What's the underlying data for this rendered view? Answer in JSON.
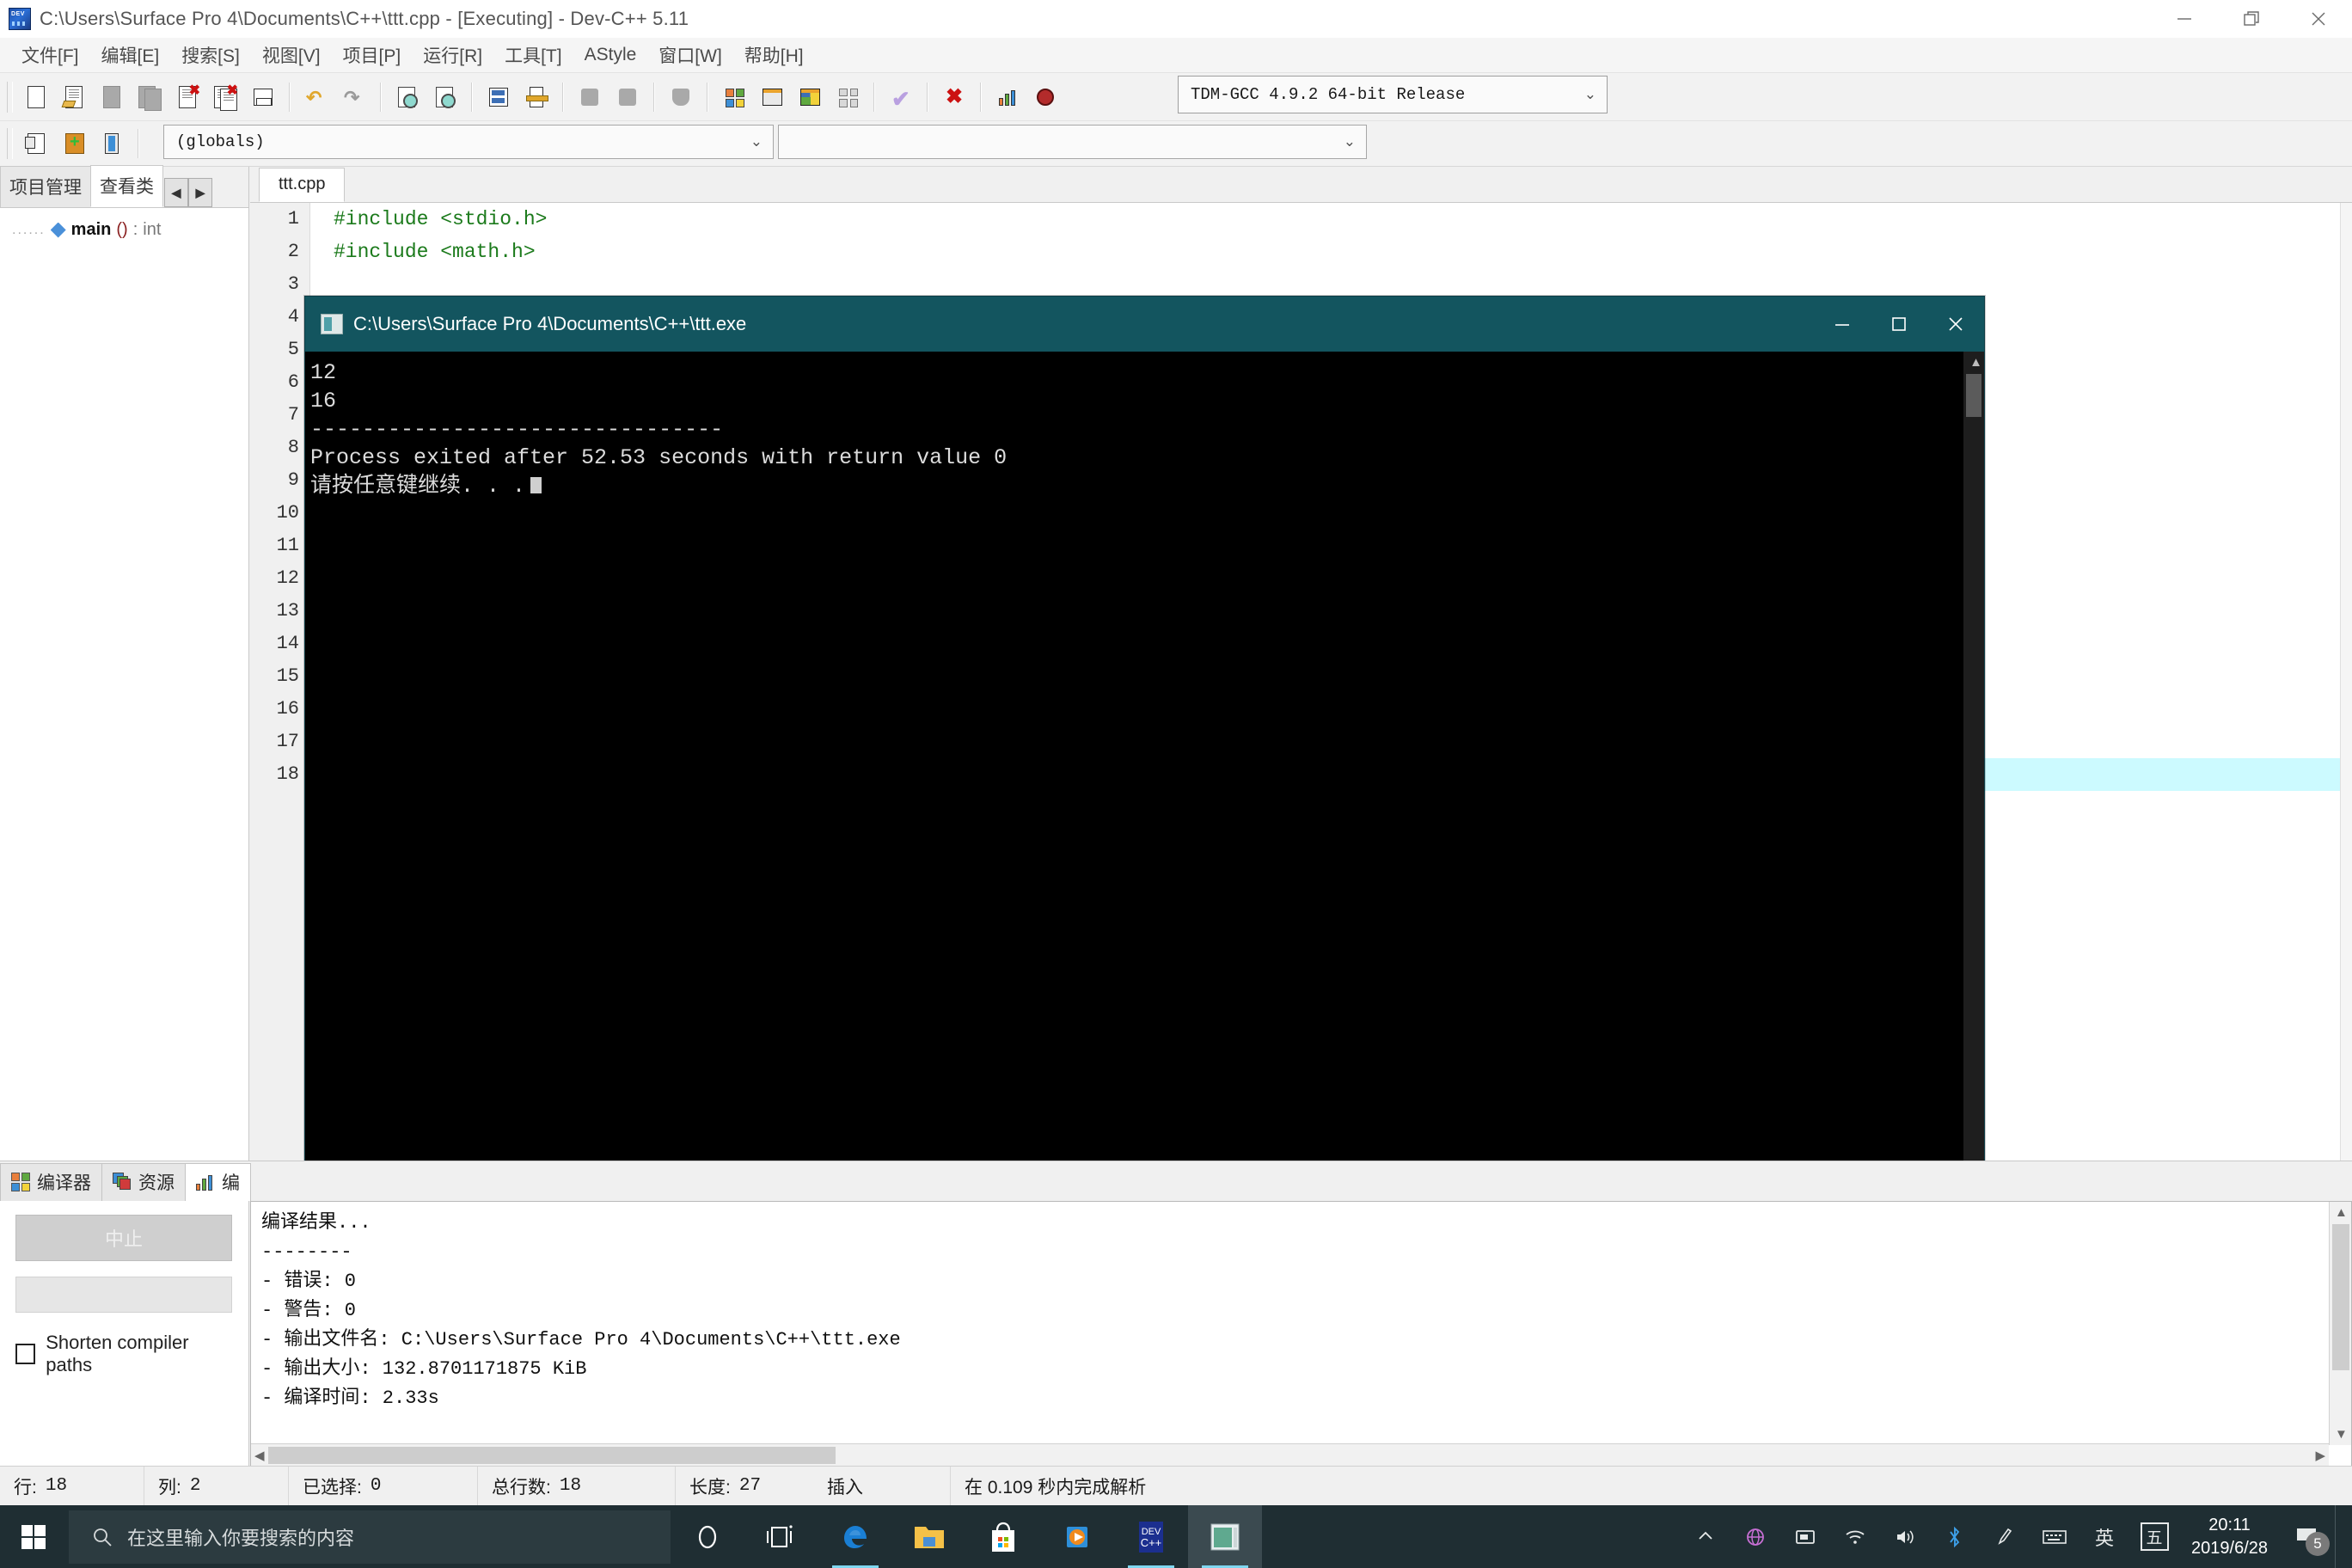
{
  "window": {
    "title": "C:\\Users\\Surface Pro 4\\Documents\\C++\\ttt.cpp - [Executing] - Dev-C++ 5.11",
    "icon": "devcpp-icon",
    "minimize": "minimize-icon",
    "restore": "restore-icon",
    "close": "close-icon"
  },
  "menubar": {
    "items": [
      {
        "label": "文件[F]"
      },
      {
        "label": "编辑[E]"
      },
      {
        "label": "搜索[S]"
      },
      {
        "label": "视图[V]"
      },
      {
        "label": "项目[P]"
      },
      {
        "label": "运行[R]"
      },
      {
        "label": "工具[T]"
      },
      {
        "label": "AStyle"
      },
      {
        "label": "窗口[W]"
      },
      {
        "label": "帮助[H]"
      }
    ]
  },
  "toolbar": {
    "compiler_select": {
      "value": "TDM-GCC 4.9.2 64-bit Release",
      "chevron": "chevron-down-icon"
    },
    "globals_select": {
      "value": "(globals)",
      "chevron": "chevron-down-icon"
    },
    "symbol_select": {
      "value": "",
      "chevron": "chevron-down-icon"
    },
    "row1_icons": [
      "new-file-icon",
      "open-file-icon",
      "save-icon",
      "save-all-icon",
      "close-file-icon",
      "close-all-icon",
      "print-icon",
      "undo-icon",
      "redo-icon",
      "find-icon",
      "find-next-icon",
      "goto-line-icon",
      "goto-function-icon",
      "back-icon",
      "forward-icon",
      "shield-icon",
      "compile-icon",
      "run-icon",
      "compile-run-icon",
      "rebuild-all-icon",
      "syntax-check-icon",
      "stop-execution-icon",
      "profile-icon",
      "debug-icon"
    ],
    "row2_icons": [
      "insert-icon",
      "toggle-icon",
      "goto-icon"
    ]
  },
  "left_panel": {
    "tabs": [
      {
        "label": "项目管理",
        "active": false
      },
      {
        "label": "查看类",
        "active": true
      }
    ],
    "spin_prev": "◀",
    "spin_next": "▶",
    "tree": [
      {
        "dots": "......",
        "icon": "method-icon",
        "name": "main",
        "paren": "()",
        "sep": " : ",
        "type": "int"
      }
    ]
  },
  "editor": {
    "tab": "ttt.cpp",
    "line_numbers": [
      "1",
      "2",
      "3",
      "4",
      "5",
      "6",
      "7",
      "8",
      "9",
      "10",
      "11",
      "12",
      "13",
      "14",
      "15",
      "16",
      "17",
      "18"
    ],
    "code_lines": [
      "#include <stdio.h>",
      "#include <math.h>",
      "",
      "",
      "",
      "",
      "",
      "",
      "",
      "",
      "",
      "",
      "",
      "",
      "",
      "",
      "",
      ""
    ],
    "current_line": 18
  },
  "console": {
    "title": "C:\\Users\\Surface Pro 4\\Documents\\C++\\ttt.exe",
    "icon": "console-icon",
    "minimize": "minimize-icon",
    "maximize": "maximize-icon",
    "close": "close-icon",
    "lines": [
      "12",
      "16",
      "--------------------------------",
      "Process exited after 52.53 seconds with return value 0",
      "请按任意键继续. . ."
    ]
  },
  "bottom_panel": {
    "tabs": [
      {
        "label": "编译器",
        "icon": "compiler-icon",
        "active": false
      },
      {
        "label": "资源",
        "icon": "resources-icon",
        "active": false
      },
      {
        "label": "编",
        "icon": "compile-log-icon",
        "active": true
      }
    ],
    "abort_button": "中止",
    "shorten_checkbox_label": "Shorten compiler paths",
    "log_lines": [
      "编译结果...",
      "--------",
      "- 错误: 0",
      "- 警告: 0",
      "- 输出文件名: C:\\Users\\Surface Pro 4\\Documents\\C++\\ttt.exe",
      "- 输出大小: 132.8701171875 KiB",
      "- 编译时间: 2.33s"
    ]
  },
  "status_bar": {
    "cells": [
      {
        "label": "行:",
        "value": "18"
      },
      {
        "label": "列:",
        "value": "2"
      },
      {
        "label": "已选择:",
        "value": "0"
      },
      {
        "label": "总行数:",
        "value": "18"
      },
      {
        "label": "长度:",
        "value": "27"
      },
      {
        "label": "插入",
        "value": ""
      },
      {
        "label": "在 0.109 秒内完成解析",
        "value": ""
      }
    ]
  },
  "taskbar": {
    "start": "windows-start-icon",
    "search_placeholder": "在这里输入你要搜索的内容",
    "search_icon": "search-icon",
    "apps": [
      {
        "name": "cortana-icon"
      },
      {
        "name": "task-view-icon"
      },
      {
        "name": "edge-icon"
      },
      {
        "name": "file-explorer-icon"
      },
      {
        "name": "microsoft-store-icon"
      },
      {
        "name": "movies-tv-icon"
      },
      {
        "name": "dev-cpp-icon"
      },
      {
        "name": "console-window-icon"
      }
    ],
    "tray": {
      "chevron_up": "show-hidden-icons-icon",
      "network_globe": "network-icon",
      "action_box": "tablet-mode-icon",
      "wifi": "wifi-icon",
      "volume": "volume-icon",
      "bluetooth": "bluetooth-icon",
      "pen": "pen-icon",
      "keyboard": "keyboard-icon",
      "ime_lang": "英",
      "ime_mode": "五",
      "time": "20:11",
      "date": "2019/6/28",
      "notification_count": "5",
      "notification_icon": "notification-icon"
    }
  },
  "colors": {
    "console_title": "#13555f",
    "current_line": "#ccfaff",
    "code_green": "#1b7a1b",
    "taskbar": "#1f2e33"
  }
}
